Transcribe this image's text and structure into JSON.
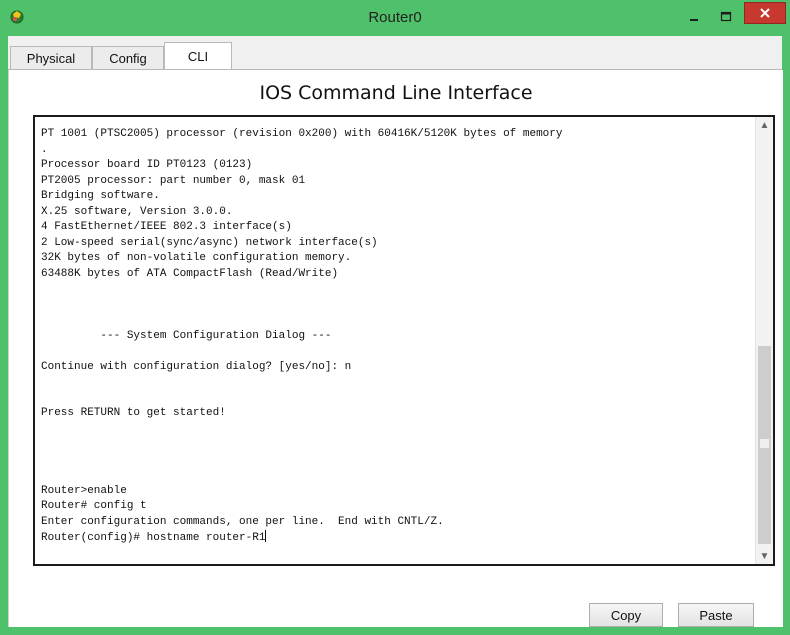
{
  "window": {
    "title": "Router0"
  },
  "tabs": [
    {
      "label": "Physical"
    },
    {
      "label": "Config"
    },
    {
      "label": "CLI",
      "active": true
    }
  ],
  "cli": {
    "heading": "IOS Command Line Interface",
    "lines": [
      "PT 1001 (PTSC2005) processor (revision 0x200) with 60416K/5120K bytes of memory",
      ".",
      "Processor board ID PT0123 (0123)",
      "PT2005 processor: part number 0, mask 01",
      "Bridging software.",
      "X.25 software, Version 3.0.0.",
      "4 FastEthernet/IEEE 802.3 interface(s)",
      "2 Low-speed serial(sync/async) network interface(s)",
      "32K bytes of non-volatile configuration memory.",
      "63488K bytes of ATA CompactFlash (Read/Write)",
      "",
      "",
      "",
      "         --- System Configuration Dialog ---",
      "",
      "Continue with configuration dialog? [yes/no]: n",
      "",
      "",
      "Press RETURN to get started!",
      "",
      "",
      "",
      "",
      "Router>enable",
      "Router# config t",
      "Enter configuration commands, one per line.  End with CNTL/Z.",
      "Router(config)# hostname router-R1"
    ]
  },
  "buttons": {
    "copy": "Copy",
    "paste": "Paste"
  },
  "colors": {
    "window_frame": "#4fc16a",
    "close_button": "#c7382e"
  },
  "icons": {
    "app": "packet-tracer-router-icon",
    "minimize": "minimize-icon",
    "maximize": "maximize-icon",
    "close": "close-icon"
  }
}
